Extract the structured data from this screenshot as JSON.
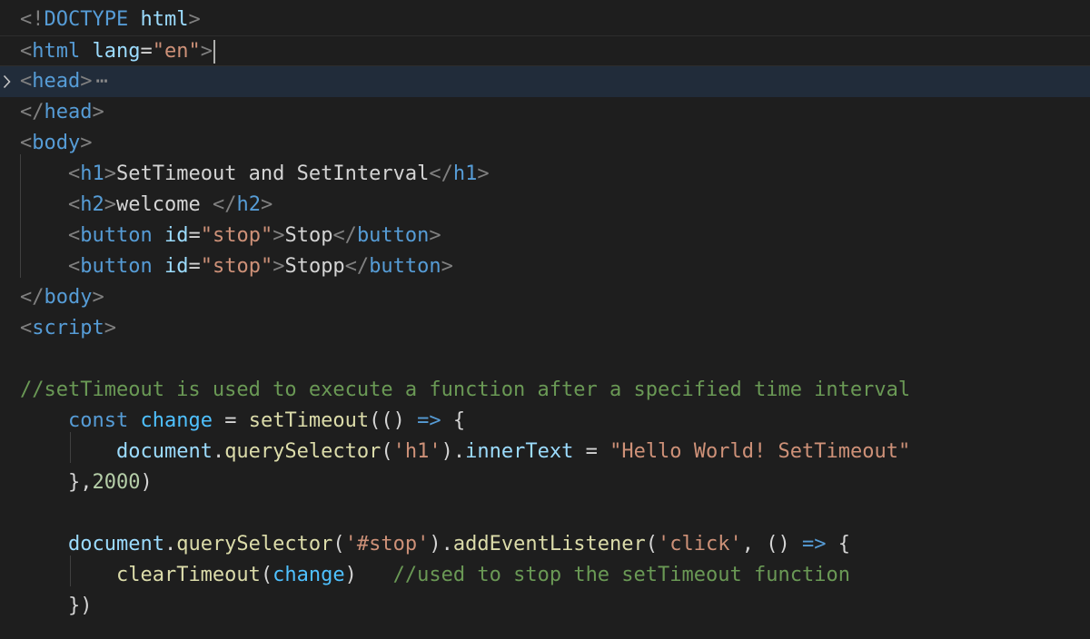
{
  "editor": {
    "language": "html",
    "active_line": 2,
    "folded_line": 3,
    "fold_indicator": "⋯",
    "colors": {
      "background": "#1e1e1e",
      "tag": "#569cd6",
      "attribute": "#9cdcfe",
      "string": "#ce9178",
      "comment": "#6a9955",
      "function": "#dcdcaa",
      "variable": "#4fc1ff",
      "number": "#b5cea8",
      "punctuation": "#808080"
    },
    "lines": [
      {
        "tokens": [
          {
            "t": "punc",
            "v": "<!"
          },
          {
            "t": "tag",
            "v": "DOCTYPE"
          },
          {
            "t": "text",
            "v": " "
          },
          {
            "t": "attr",
            "v": "html"
          },
          {
            "t": "punc",
            "v": ">"
          }
        ]
      },
      {
        "tokens": [
          {
            "t": "punc",
            "v": "<"
          },
          {
            "t": "tag",
            "v": "html"
          },
          {
            "t": "text",
            "v": " "
          },
          {
            "t": "attr",
            "v": "lang"
          },
          {
            "t": "text",
            "v": "="
          },
          {
            "t": "str",
            "v": "\"en\""
          },
          {
            "t": "punc",
            "v": ">"
          }
        ]
      },
      {
        "tokens": [
          {
            "t": "punc",
            "v": "<"
          },
          {
            "t": "tag",
            "v": "head"
          },
          {
            "t": "punc",
            "v": ">"
          }
        ]
      },
      {
        "tokens": [
          {
            "t": "punc",
            "v": "</"
          },
          {
            "t": "tag",
            "v": "head"
          },
          {
            "t": "punc",
            "v": ">"
          }
        ]
      },
      {
        "tokens": [
          {
            "t": "punc",
            "v": "<"
          },
          {
            "t": "tag",
            "v": "body"
          },
          {
            "t": "punc",
            "v": ">"
          }
        ]
      },
      {
        "tokens": [
          {
            "t": "text",
            "v": "    "
          },
          {
            "t": "punc",
            "v": "<"
          },
          {
            "t": "tag",
            "v": "h1"
          },
          {
            "t": "punc",
            "v": ">"
          },
          {
            "t": "text",
            "v": "SetTimeout and SetInterval"
          },
          {
            "t": "punc",
            "v": "</"
          },
          {
            "t": "tag",
            "v": "h1"
          },
          {
            "t": "punc",
            "v": ">"
          }
        ]
      },
      {
        "tokens": [
          {
            "t": "text",
            "v": "    "
          },
          {
            "t": "punc",
            "v": "<"
          },
          {
            "t": "tag",
            "v": "h2"
          },
          {
            "t": "punc",
            "v": ">"
          },
          {
            "t": "text",
            "v": "welcome "
          },
          {
            "t": "punc",
            "v": "</"
          },
          {
            "t": "tag",
            "v": "h2"
          },
          {
            "t": "punc",
            "v": ">"
          }
        ]
      },
      {
        "tokens": [
          {
            "t": "text",
            "v": "    "
          },
          {
            "t": "punc",
            "v": "<"
          },
          {
            "t": "tag",
            "v": "button"
          },
          {
            "t": "text",
            "v": " "
          },
          {
            "t": "attr",
            "v": "id"
          },
          {
            "t": "text",
            "v": "="
          },
          {
            "t": "str",
            "v": "\"stop\""
          },
          {
            "t": "punc",
            "v": ">"
          },
          {
            "t": "text",
            "v": "Stop"
          },
          {
            "t": "punc",
            "v": "</"
          },
          {
            "t": "tag",
            "v": "button"
          },
          {
            "t": "punc",
            "v": ">"
          }
        ]
      },
      {
        "tokens": [
          {
            "t": "text",
            "v": "    "
          },
          {
            "t": "punc",
            "v": "<"
          },
          {
            "t": "tag",
            "v": "button"
          },
          {
            "t": "text",
            "v": " "
          },
          {
            "t": "attr",
            "v": "id"
          },
          {
            "t": "text",
            "v": "="
          },
          {
            "t": "str",
            "v": "\"stop\""
          },
          {
            "t": "punc",
            "v": ">"
          },
          {
            "t": "text",
            "v": "Stopp"
          },
          {
            "t": "punc",
            "v": "</"
          },
          {
            "t": "tag",
            "v": "button"
          },
          {
            "t": "punc",
            "v": ">"
          }
        ]
      },
      {
        "tokens": [
          {
            "t": "punc",
            "v": "</"
          },
          {
            "t": "tag",
            "v": "body"
          },
          {
            "t": "punc",
            "v": ">"
          }
        ]
      },
      {
        "tokens": [
          {
            "t": "punc",
            "v": "<"
          },
          {
            "t": "tag",
            "v": "script"
          },
          {
            "t": "punc",
            "v": ">"
          }
        ]
      },
      {
        "tokens": []
      },
      {
        "tokens": [
          {
            "t": "comment",
            "v": "//setTimeout is used to execute a function after a specified time interval"
          }
        ]
      },
      {
        "tokens": [
          {
            "t": "text",
            "v": "    "
          },
          {
            "t": "kw",
            "v": "const"
          },
          {
            "t": "text",
            "v": " "
          },
          {
            "t": "var",
            "v": "change"
          },
          {
            "t": "op",
            "v": " = "
          },
          {
            "t": "func",
            "v": "setTimeout"
          },
          {
            "t": "text",
            "v": "(() "
          },
          {
            "t": "kw",
            "v": "=>"
          },
          {
            "t": "text",
            "v": " {"
          }
        ]
      },
      {
        "tokens": [
          {
            "t": "text",
            "v": "        "
          },
          {
            "t": "ident",
            "v": "document"
          },
          {
            "t": "text",
            "v": "."
          },
          {
            "t": "func",
            "v": "querySelector"
          },
          {
            "t": "text",
            "v": "("
          },
          {
            "t": "str",
            "v": "'h1'"
          },
          {
            "t": "text",
            "v": ")."
          },
          {
            "t": "ident",
            "v": "innerText"
          },
          {
            "t": "op",
            "v": " = "
          },
          {
            "t": "str",
            "v": "\"Hello World! SetTimeout\""
          }
        ]
      },
      {
        "tokens": [
          {
            "t": "text",
            "v": "    },"
          },
          {
            "t": "num",
            "v": "2000"
          },
          {
            "t": "text",
            "v": ")"
          }
        ]
      },
      {
        "tokens": []
      },
      {
        "tokens": [
          {
            "t": "text",
            "v": "    "
          },
          {
            "t": "ident",
            "v": "document"
          },
          {
            "t": "text",
            "v": "."
          },
          {
            "t": "func",
            "v": "querySelector"
          },
          {
            "t": "text",
            "v": "("
          },
          {
            "t": "str",
            "v": "'#stop'"
          },
          {
            "t": "text",
            "v": ")."
          },
          {
            "t": "func",
            "v": "addEventListener"
          },
          {
            "t": "text",
            "v": "("
          },
          {
            "t": "str",
            "v": "'click'"
          },
          {
            "t": "text",
            "v": ", () "
          },
          {
            "t": "kw",
            "v": "=>"
          },
          {
            "t": "text",
            "v": " {"
          }
        ]
      },
      {
        "tokens": [
          {
            "t": "text",
            "v": "        "
          },
          {
            "t": "func",
            "v": "clearTimeout"
          },
          {
            "t": "text",
            "v": "("
          },
          {
            "t": "var",
            "v": "change"
          },
          {
            "t": "text",
            "v": ")   "
          },
          {
            "t": "comment",
            "v": "//used to stop the setTimeout function"
          }
        ]
      },
      {
        "tokens": [
          {
            "t": "text",
            "v": "    })"
          }
        ]
      },
      {
        "tokens": []
      }
    ]
  }
}
